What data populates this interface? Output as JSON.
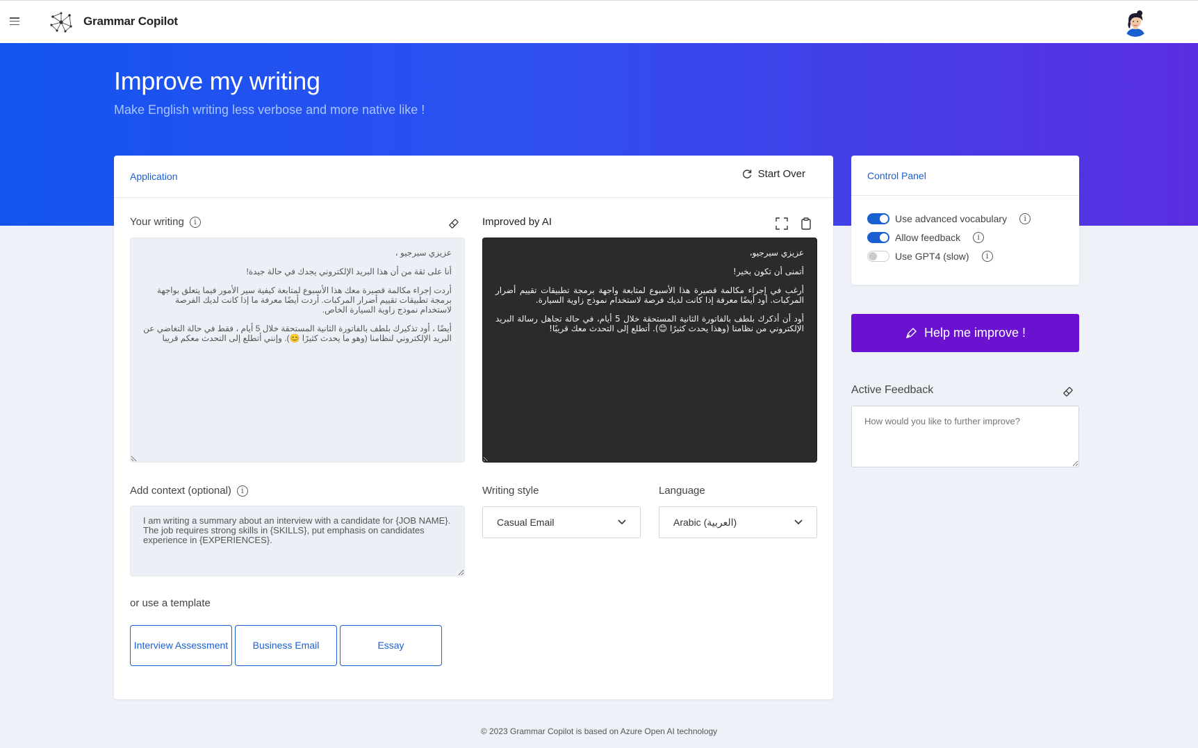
{
  "topbar": {
    "brand": "Grammar Copilot",
    "menu_icon": "hamburger-menu-icon",
    "logo_icon": "network-logo-icon",
    "avatar_icon": "user-avatar-icon"
  },
  "hero": {
    "title": "Improve my writing",
    "subtitle": "Make English writing less verbose and more native like !"
  },
  "application": {
    "tab_label": "Application",
    "start_over_label": "Start Over",
    "your_writing_label": "Your writing",
    "your_writing_paragraphs": [
      "عزيزي سيرجيو ،",
      "أنا على ثقة من أن هذا البريد الإلكتروني يجدك في حالة جيدة!",
      "أردت إجراء مكالمة قصيرة معك هذا الأسبوع لمتابعة كيفية سير الأمور فيما يتعلق بواجهة برمجة تطبيقات تقييم أضرار المركبات. أردت أيضًا معرفة ما إذا كانت لديك الفرصة لاستخدام نموذج زاوية السيارة الخاص.",
      "أيضًا ، أود تذكيرك بلطف بالفاتورة الثانية المستحقة خلال 5 أيام ، فقط في حالة التغاضي عن البريد الإلكتروني لنظامنا (وهو ما يحدث كثيرًا 😊). وإنني أتطلع إلى التحدث معكم قريبا"
    ],
    "improved_label": "Improved by AI",
    "improved_paragraphs": [
      "عزيزي سيرجيو،",
      "أتمنى أن تكون بخير!",
      "أرغب في إجراء مكالمة قصيرة هذا الأسبوع لمتابعة واجهة برمجة تطبيقات تقييم أضرار المركبات. أود أيضًا معرفة إذا كانت لديك فرصة لاستخدام نموذج زاوية السيارة.",
      "أود أن أذكرك بلطف بالفاتورة الثانية المستحقة خلال 5 أيام، في حالة تجاهل رسالة البريد الإلكتروني من نظامنا (وهذا يحدث كثيرًا 😊). أتطلع إلى التحدث معك قريبًا!"
    ],
    "context_label": "Add context (optional)",
    "context_value": "I am writing a summary about an interview with a candidate for {JOB NAME}. The job requires strong skills in {SKILLS}, put emphasis on candidates experience in {EXPERIENCES}.",
    "writing_style_label": "Writing style",
    "writing_style_value": "Casual Email",
    "language_label": "Language",
    "language_value": "Arabic (العربية)",
    "template_label": "or use a template",
    "templates": [
      "Interview Assessment",
      "Business Email",
      "Essay"
    ]
  },
  "control_panel": {
    "tab_label": "Control Panel",
    "toggles": [
      {
        "label": "Use advanced vocabulary",
        "on": true
      },
      {
        "label": "Allow feedback",
        "on": true
      },
      {
        "label": "Use GPT4 (slow)",
        "on": false
      }
    ]
  },
  "help_button_label": "Help me improve !",
  "feedback": {
    "label": "Active Feedback",
    "placeholder": "How would you like to further improve?"
  },
  "footer": "© 2023 Grammar Copilot is based on Azure Open AI technology",
  "colors": {
    "accent": "#1a5fd0",
    "hero_start": "#1455f0",
    "hero_end": "#5a2ee0",
    "help_button": "#6b12d0",
    "dark_panel": "#2a2b2c"
  }
}
